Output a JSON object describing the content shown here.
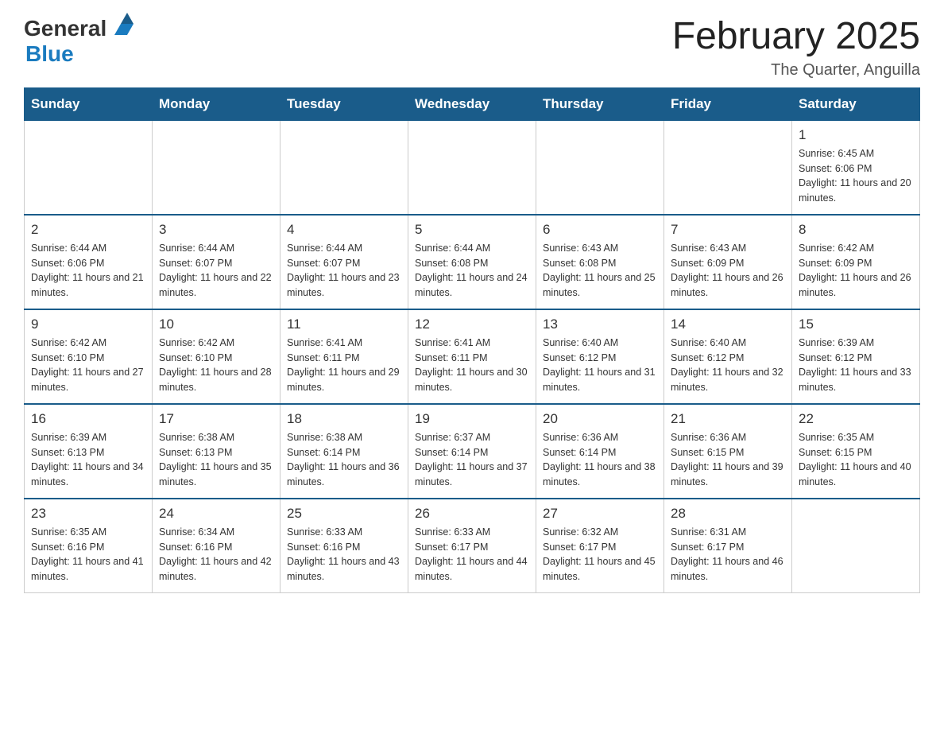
{
  "header": {
    "logo_general": "General",
    "logo_blue": "Blue",
    "month_title": "February 2025",
    "subtitle": "The Quarter, Anguilla"
  },
  "days_of_week": [
    "Sunday",
    "Monday",
    "Tuesday",
    "Wednesday",
    "Thursday",
    "Friday",
    "Saturday"
  ],
  "weeks": [
    [
      {
        "day": "",
        "info": ""
      },
      {
        "day": "",
        "info": ""
      },
      {
        "day": "",
        "info": ""
      },
      {
        "day": "",
        "info": ""
      },
      {
        "day": "",
        "info": ""
      },
      {
        "day": "",
        "info": ""
      },
      {
        "day": "1",
        "info": "Sunrise: 6:45 AM\nSunset: 6:06 PM\nDaylight: 11 hours and 20 minutes."
      }
    ],
    [
      {
        "day": "2",
        "info": "Sunrise: 6:44 AM\nSunset: 6:06 PM\nDaylight: 11 hours and 21 minutes."
      },
      {
        "day": "3",
        "info": "Sunrise: 6:44 AM\nSunset: 6:07 PM\nDaylight: 11 hours and 22 minutes."
      },
      {
        "day": "4",
        "info": "Sunrise: 6:44 AM\nSunset: 6:07 PM\nDaylight: 11 hours and 23 minutes."
      },
      {
        "day": "5",
        "info": "Sunrise: 6:44 AM\nSunset: 6:08 PM\nDaylight: 11 hours and 24 minutes."
      },
      {
        "day": "6",
        "info": "Sunrise: 6:43 AM\nSunset: 6:08 PM\nDaylight: 11 hours and 25 minutes."
      },
      {
        "day": "7",
        "info": "Sunrise: 6:43 AM\nSunset: 6:09 PM\nDaylight: 11 hours and 26 minutes."
      },
      {
        "day": "8",
        "info": "Sunrise: 6:42 AM\nSunset: 6:09 PM\nDaylight: 11 hours and 26 minutes."
      }
    ],
    [
      {
        "day": "9",
        "info": "Sunrise: 6:42 AM\nSunset: 6:10 PM\nDaylight: 11 hours and 27 minutes."
      },
      {
        "day": "10",
        "info": "Sunrise: 6:42 AM\nSunset: 6:10 PM\nDaylight: 11 hours and 28 minutes."
      },
      {
        "day": "11",
        "info": "Sunrise: 6:41 AM\nSunset: 6:11 PM\nDaylight: 11 hours and 29 minutes."
      },
      {
        "day": "12",
        "info": "Sunrise: 6:41 AM\nSunset: 6:11 PM\nDaylight: 11 hours and 30 minutes."
      },
      {
        "day": "13",
        "info": "Sunrise: 6:40 AM\nSunset: 6:12 PM\nDaylight: 11 hours and 31 minutes."
      },
      {
        "day": "14",
        "info": "Sunrise: 6:40 AM\nSunset: 6:12 PM\nDaylight: 11 hours and 32 minutes."
      },
      {
        "day": "15",
        "info": "Sunrise: 6:39 AM\nSunset: 6:12 PM\nDaylight: 11 hours and 33 minutes."
      }
    ],
    [
      {
        "day": "16",
        "info": "Sunrise: 6:39 AM\nSunset: 6:13 PM\nDaylight: 11 hours and 34 minutes."
      },
      {
        "day": "17",
        "info": "Sunrise: 6:38 AM\nSunset: 6:13 PM\nDaylight: 11 hours and 35 minutes."
      },
      {
        "day": "18",
        "info": "Sunrise: 6:38 AM\nSunset: 6:14 PM\nDaylight: 11 hours and 36 minutes."
      },
      {
        "day": "19",
        "info": "Sunrise: 6:37 AM\nSunset: 6:14 PM\nDaylight: 11 hours and 37 minutes."
      },
      {
        "day": "20",
        "info": "Sunrise: 6:36 AM\nSunset: 6:14 PM\nDaylight: 11 hours and 38 minutes."
      },
      {
        "day": "21",
        "info": "Sunrise: 6:36 AM\nSunset: 6:15 PM\nDaylight: 11 hours and 39 minutes."
      },
      {
        "day": "22",
        "info": "Sunrise: 6:35 AM\nSunset: 6:15 PM\nDaylight: 11 hours and 40 minutes."
      }
    ],
    [
      {
        "day": "23",
        "info": "Sunrise: 6:35 AM\nSunset: 6:16 PM\nDaylight: 11 hours and 41 minutes."
      },
      {
        "day": "24",
        "info": "Sunrise: 6:34 AM\nSunset: 6:16 PM\nDaylight: 11 hours and 42 minutes."
      },
      {
        "day": "25",
        "info": "Sunrise: 6:33 AM\nSunset: 6:16 PM\nDaylight: 11 hours and 43 minutes."
      },
      {
        "day": "26",
        "info": "Sunrise: 6:33 AM\nSunset: 6:17 PM\nDaylight: 11 hours and 44 minutes."
      },
      {
        "day": "27",
        "info": "Sunrise: 6:32 AM\nSunset: 6:17 PM\nDaylight: 11 hours and 45 minutes."
      },
      {
        "day": "28",
        "info": "Sunrise: 6:31 AM\nSunset: 6:17 PM\nDaylight: 11 hours and 46 minutes."
      },
      {
        "day": "",
        "info": ""
      }
    ]
  ]
}
